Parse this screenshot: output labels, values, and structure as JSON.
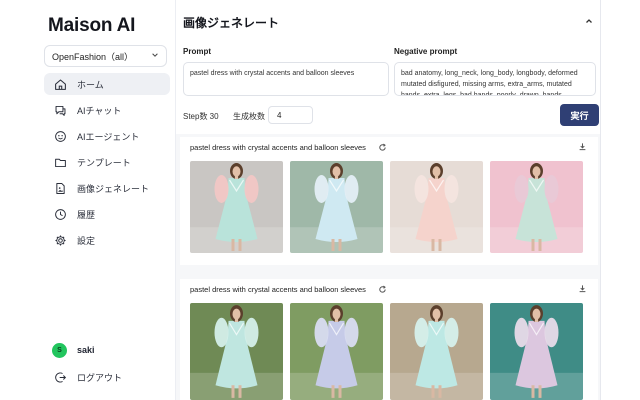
{
  "app": {
    "logo": "Maison AI"
  },
  "sidebar": {
    "org_select": "OpenFashion（all）",
    "items": [
      {
        "label": "ホーム",
        "icon": "home-icon",
        "active": true
      },
      {
        "label": "AIチャット",
        "icon": "chat-icon",
        "active": false
      },
      {
        "label": "AIエージェント",
        "icon": "agent-icon",
        "active": false
      },
      {
        "label": "テンプレート",
        "icon": "folder-icon",
        "active": false
      },
      {
        "label": "画像ジェネレート",
        "icon": "image-file-icon",
        "active": false
      },
      {
        "label": "履歴",
        "icon": "history-icon",
        "active": false
      },
      {
        "label": "設定",
        "icon": "gear-icon",
        "active": false
      }
    ],
    "user": {
      "name": "saki",
      "avatar_letter": "S",
      "avatar_color": "#22c55e"
    },
    "logout_label": "ログアウト"
  },
  "main": {
    "title": "画像ジェネレート",
    "prompt_label": "Prompt",
    "prompt_value": "pastel dress with crystal accents and balloon sleeves",
    "negative_label": "Negative prompt",
    "negative_value": "bad anatomy, long_neck, long_body, longbody, deformed mutated disfigured, missing arms, extra_arms, mutated hands, extra_legs, bad hands, poorly_drawn_hands, malformed_hands, missing_limb, floating_limbs",
    "step_label": "Step数 30",
    "count_label": "生成枚数",
    "count_value": "4",
    "run_label": "実行",
    "accent_color": "#2f3f74"
  },
  "results": [
    {
      "prompt": "pastel dress with crystal accents and balloon sleeves",
      "images": [
        {
          "name": "studio-blush-sleeve-dress",
          "bg": "#c9c6c3",
          "dress": "#b9e3da",
          "sleeve": "#f2c7c5"
        },
        {
          "name": "balloons-outdoor-dress",
          "bg": "#9fb8a8",
          "dress": "#cfe9f2",
          "sleeve": "#e4eef5"
        },
        {
          "name": "balloon-wall-dress",
          "bg": "#e6dcd6",
          "dress": "#f5d3cc",
          "sleeve": "#f4e4df"
        },
        {
          "name": "pink-balloons-dress",
          "bg": "#f0c2cf",
          "dress": "#c7e3d8",
          "sleeve": "#e8c9d6"
        }
      ]
    },
    {
      "prompt": "pastel dress with crystal accents and balloon sleeves",
      "images": [
        {
          "name": "garden-mint-dress",
          "bg": "#6f8a55",
          "dress": "#bfe6e0",
          "sleeve": "#d4efea"
        },
        {
          "name": "balloon-park-dress",
          "bg": "#7f9c62",
          "dress": "#c6cbe8",
          "sleeve": "#d9dcf1"
        },
        {
          "name": "arch-terrace-dress",
          "bg": "#b7a88f",
          "dress": "#bde8e4",
          "sleeve": "#d5f0ec"
        },
        {
          "name": "teal-door-dress",
          "bg": "#3f8c86",
          "dress": "#dcc7df",
          "sleeve": "#e8dbe9"
        }
      ]
    }
  ]
}
